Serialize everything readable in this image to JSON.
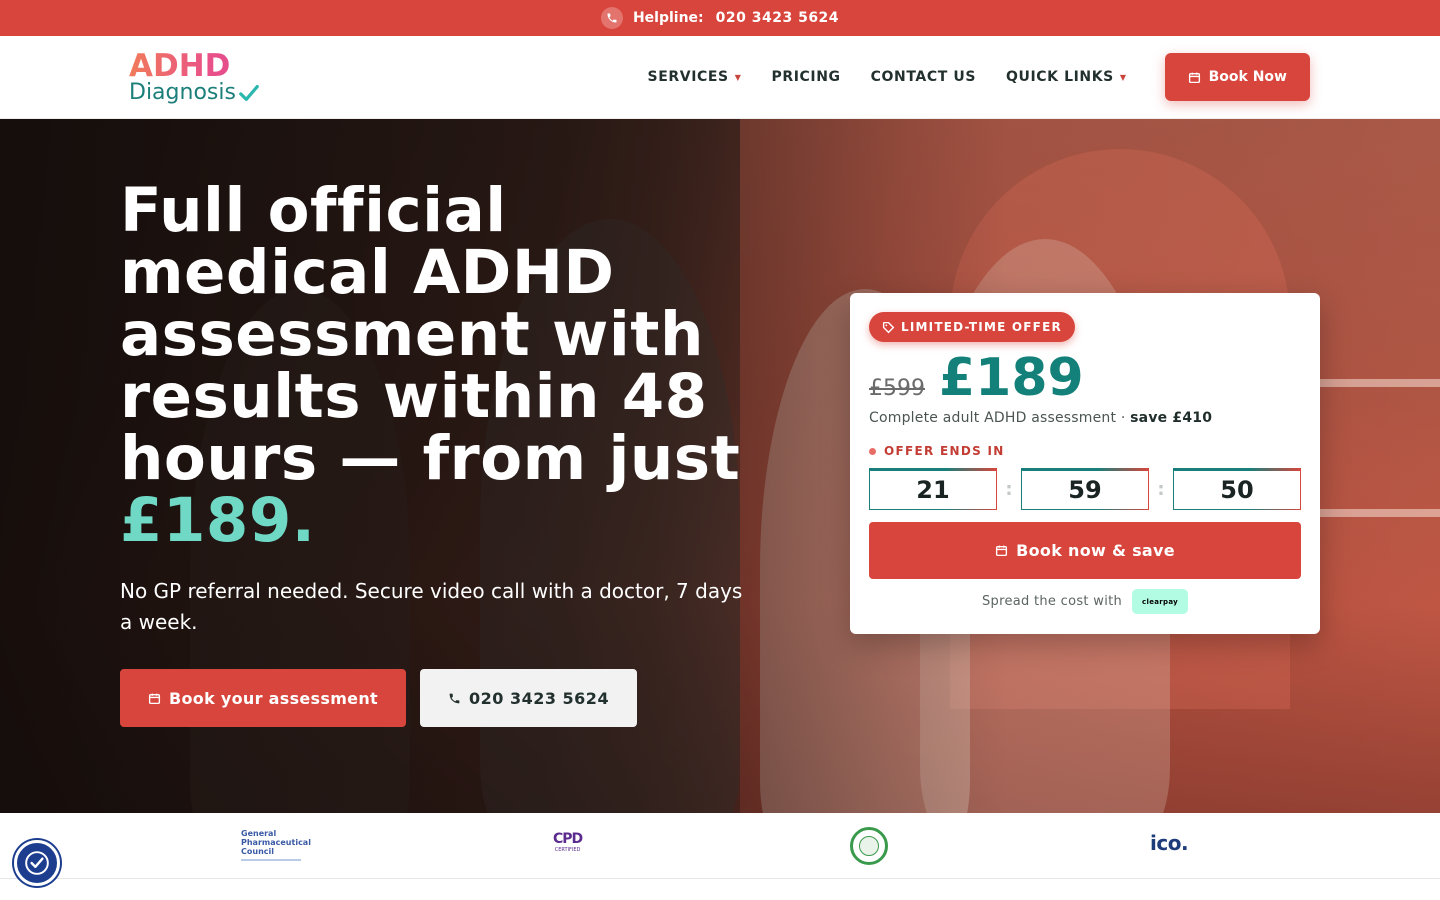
{
  "topbar": {
    "helpline_label": "Helpline:",
    "helpline_number": "020 3423 5624"
  },
  "logo": {
    "line1": "ADHD",
    "line2": "Diagnosis"
  },
  "nav": {
    "items": [
      {
        "label": "SERVICES",
        "has_dropdown": true
      },
      {
        "label": "PRICING",
        "has_dropdown": false
      },
      {
        "label": "CONTACT US",
        "has_dropdown": false
      },
      {
        "label": "QUICK LINKS",
        "has_dropdown": true
      }
    ],
    "book_label": "Book Now"
  },
  "hero": {
    "title": "Full official medical ADHD assessment with results within 48 hours — from just ",
    "title_accent": "£189.",
    "subtitle": "No GP referral needed. Secure video call with a doctor, 7 days a week.",
    "primary_button": "Book your assessment",
    "call_button": "020 3423 5624"
  },
  "offer": {
    "badge": "LIMITED-TIME OFFER",
    "old_price": "£599",
    "new_price": "£189",
    "description": "Complete adult ADHD assessment · ",
    "saving": "save £410",
    "ends_label": "OFFER ENDS IN",
    "timer": {
      "hours": "21",
      "minutes": "59",
      "seconds": "50"
    },
    "button": "Book now & save",
    "spread_label": "Spread the cost with",
    "spread_provider": "clearpay"
  },
  "trust_logos": {
    "gpc": [
      "General",
      "Pharmaceutical",
      "Council"
    ],
    "cpd": {
      "mark": "CPD",
      "sub": "CERTIFIED"
    },
    "ico": "ico."
  },
  "colors": {
    "brand_red": "#d8453c",
    "brand_teal": "#14807a",
    "accent_mint": "#6fd9c6"
  }
}
